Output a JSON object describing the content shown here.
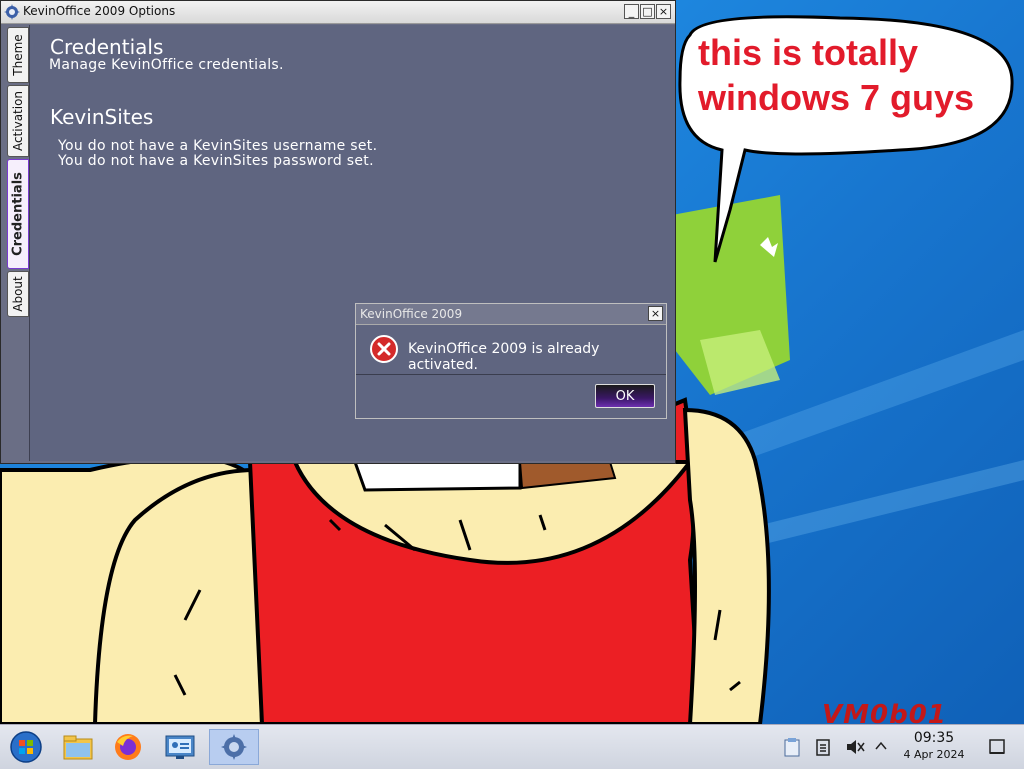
{
  "window": {
    "title": "KevinOffice 2009 Options",
    "minimize_glyph": "_",
    "maximize_glyph": "□",
    "close_glyph": "×",
    "tabs": [
      {
        "label": "Theme"
      },
      {
        "label": "Activation"
      },
      {
        "label": "Credentials",
        "active": true
      },
      {
        "label": "About"
      }
    ]
  },
  "content": {
    "section1_heading": "Credentials",
    "section1_text": "Manage KevinOffice credentials.",
    "section2_heading": "KevinSites",
    "username_status": "You do not have a KevinSites username set.",
    "password_status": "You do not have a KevinSites password set."
  },
  "dialog": {
    "title": "KevinOffice 2009",
    "message": "KevinOffice 2009 is already activated.",
    "ok_label": "OK",
    "close_glyph": "×",
    "icon": "error-icon"
  },
  "desktop": {
    "bubble_line1": "this is totally",
    "bubble_line2": "windows 7 guys",
    "watermark": "VM0b01"
  },
  "taskbar": {
    "items": [
      "start-orb-icon",
      "file-manager-icon",
      "firefox-icon",
      "control-panel-icon",
      "kevinoffice-options-icon"
    ],
    "tray_icons": [
      "clipboard-icon",
      "notes-icon",
      "volume-muted-icon",
      "chevron-up-icon"
    ],
    "time": "09:35",
    "date": "4 Apr 2024"
  },
  "colors": {
    "window_bg": "#5f6580",
    "accent_purple": "#6c2fb0",
    "error_red": "#d42a2a",
    "bubble_text": "#e21b2b"
  }
}
